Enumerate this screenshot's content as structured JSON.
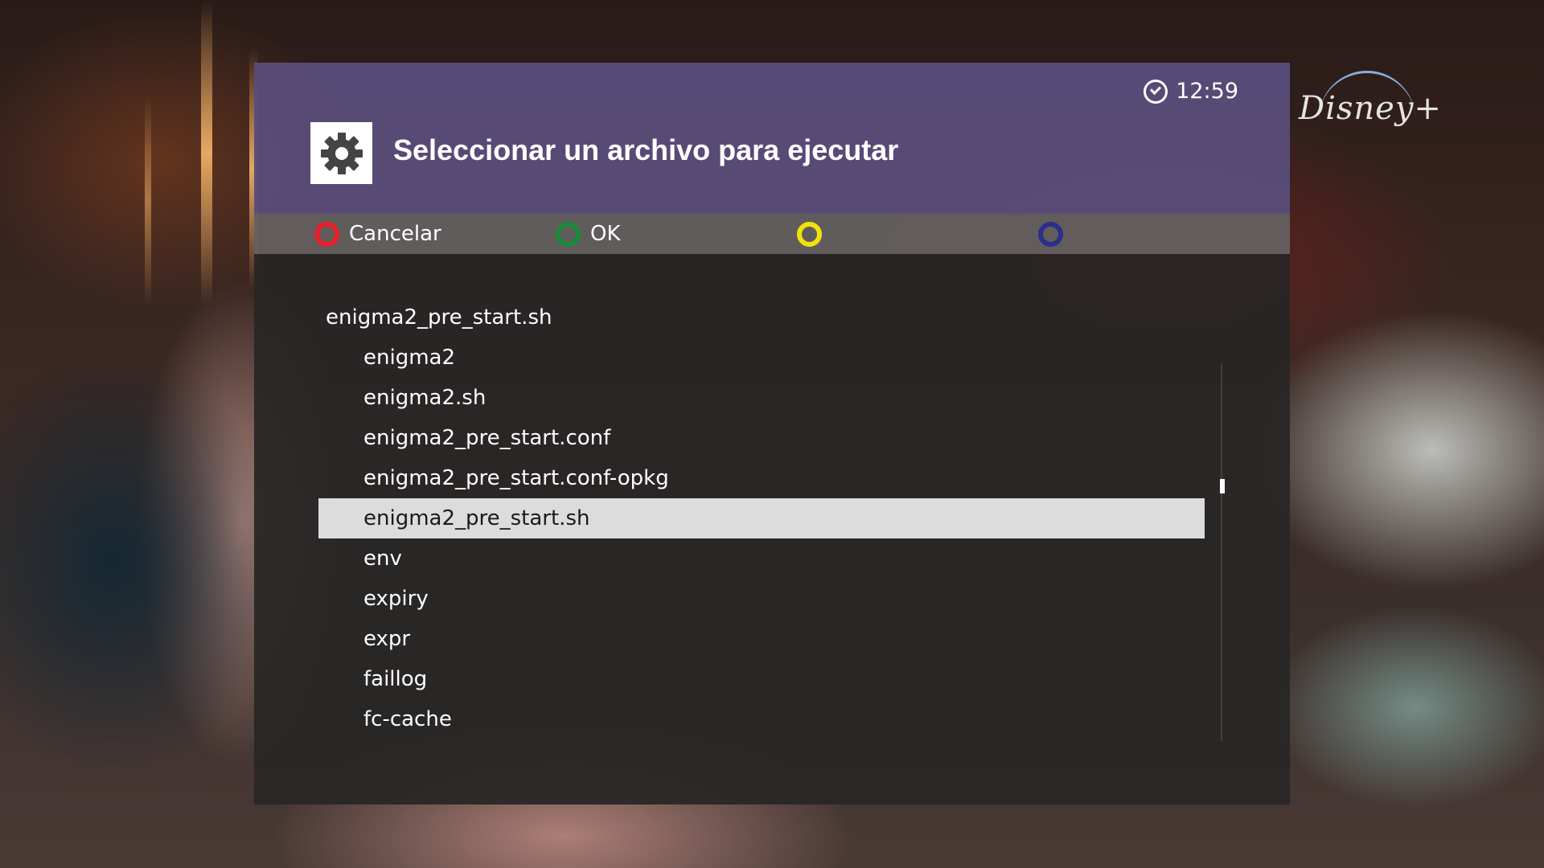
{
  "overlay": {
    "brand_logo": "Disney+"
  },
  "dialog": {
    "clock_time": "12:59",
    "title": "Seleccionar un archivo para ejecutar",
    "title_icon": "gear-icon"
  },
  "color_buttons": [
    {
      "key": "red",
      "color": "#e5202a",
      "label": "Cancelar"
    },
    {
      "key": "green",
      "color": "#1c8a3a",
      "label": "OK"
    },
    {
      "key": "yellow",
      "color": "#f2e20b",
      "label": ""
    },
    {
      "key": "blue",
      "color": "#2a2e8c",
      "label": ""
    }
  ],
  "file_browser": {
    "current_path": "enigma2_pre_start.sh",
    "items": [
      "enigma2",
      "enigma2.sh",
      "enigma2_pre_start.conf",
      "enigma2_pre_start.conf-opkg",
      "enigma2_pre_start.sh",
      "env",
      "expiry",
      "expr",
      "faillog",
      "fc-cache"
    ],
    "selected_index": 4
  }
}
